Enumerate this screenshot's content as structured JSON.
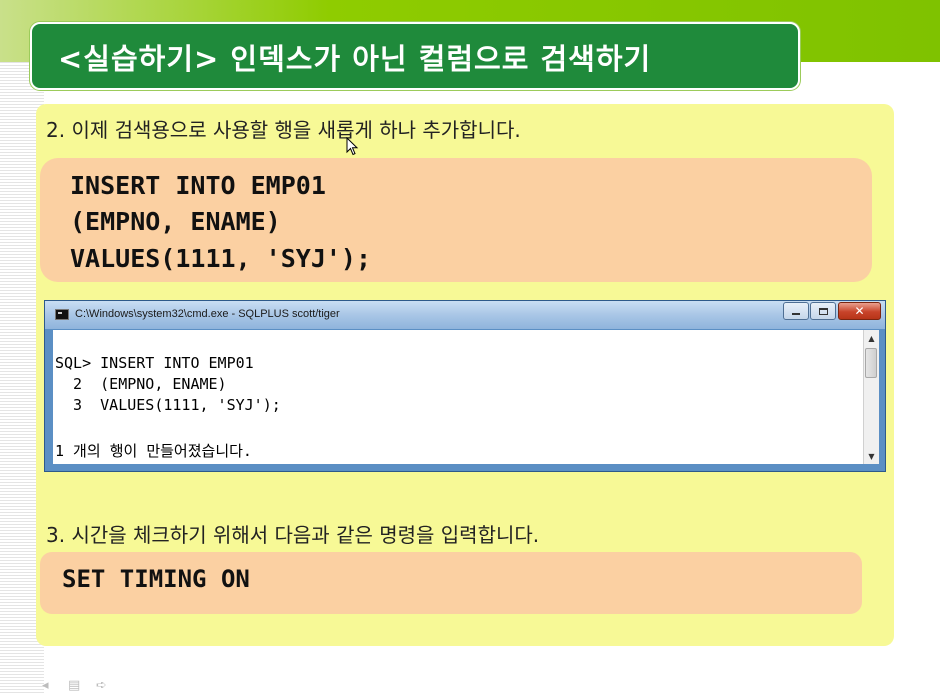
{
  "slide": {
    "title": "<실습하기> 인덱스가 아닌 컬럼으로 검색하기",
    "step2": {
      "text": "2. 이제 검색용으로 사용할 행을 새롭게 하나 추가합니다.",
      "code": [
        "INSERT INTO EMP01",
        "(EMPNO, ENAME)",
        "VALUES(1111, 'SYJ');"
      ]
    },
    "step3": {
      "text": "3. 시간을 체크하기 위해서 다음과 같은 명령을 입력합니다.",
      "code": "SET TIMING ON"
    }
  },
  "cmd_window": {
    "title": "C:\\Windows\\system32\\cmd.exe - SQLPLUS  scott/tiger",
    "icon": "console-icon",
    "buttons": {
      "minimize": "minimize-icon",
      "maximize": "maximize-icon",
      "close": "close-icon"
    },
    "lines": [
      "SQL> INSERT INTO EMP01",
      "  2  (EMPNO, ENAME)",
      "  3  VALUES(1111, 'SYJ');",
      "",
      "1 개의 행이 만들어졌습니다."
    ]
  },
  "colors": {
    "title_bg": "#1f8a3b",
    "panel_bg": "#f7f996",
    "code_bg": "#fbd0a2",
    "accent_green": "#8fcc00"
  },
  "bottom_nav": {
    "icons": [
      "prev-icon",
      "menu-icon",
      "next-icon"
    ]
  }
}
